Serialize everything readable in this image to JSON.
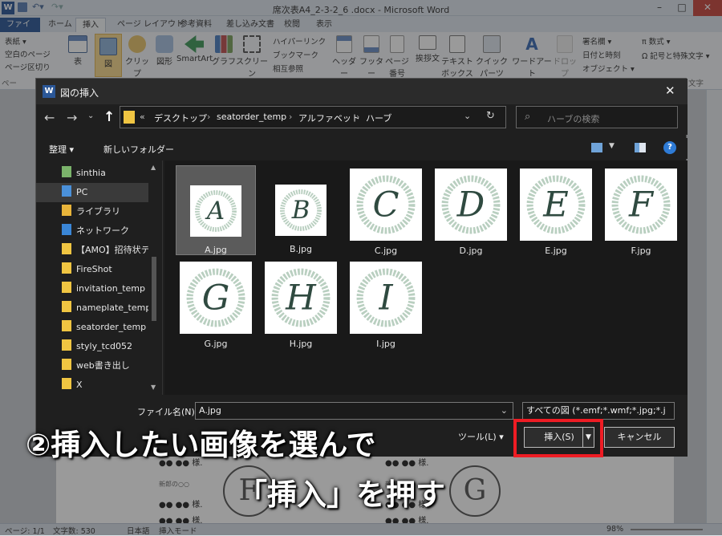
{
  "window": {
    "title": "席次表A4_2-3-2_6 .docx - Microsoft Word"
  },
  "ribbon": {
    "tabs": [
      "ファイル",
      "ホーム",
      "挿入",
      "ページ レイアウト",
      "参考資料",
      "差し込み文書",
      "校閲",
      "表示"
    ],
    "active_tab": "挿入",
    "page_group": [
      "表紙 ▾",
      "空白のページ",
      "ページ区切り"
    ],
    "group_page_label": "ペー",
    "table_label": "表",
    "image_label": "図",
    "clipart_label": "クリップ\nアート",
    "shapes_label": "図形",
    "smartart_label": "SmartArt",
    "chart_label": "グラフ",
    "screenshot_label": "スクリーン\nショット",
    "links": [
      "ハイパーリンク",
      "ブックマーク",
      "相互参照"
    ],
    "header_label": "ヘッダー",
    "footer_label": "フッター",
    "pagenum_label": "ページ\n番号",
    "textbox_label": "テキスト\nボックス",
    "greeting_label": "挨拶文",
    "quickparts_label": "クイック パーツ",
    "wordart_label": "ワードアート",
    "dropcap_label": "ドロップ\nキャップ",
    "right_group": [
      "署名欄 ▾",
      "日付と時刻",
      "オブジェクト ▾"
    ],
    "symbols": [
      "π 数式 ▾",
      "Ω 記号と特殊文字 ▾"
    ],
    "moji_label": "文字"
  },
  "document": {
    "rows": [
      {
        "name": "●● ●●",
        "honor": "様"
      },
      {
        "name": "●● ●●",
        "honor": "様"
      },
      {
        "name": "●● ●●",
        "honor": "様"
      }
    ],
    "caption": "新郎の○○",
    "circle_left": "F",
    "circle_right": "G"
  },
  "statusbar": {
    "page": "ページ: 1/1",
    "words": "文字数: 530",
    "lang": "日本語",
    "mode": "挿入モード",
    "zoom": "98%"
  },
  "dialog": {
    "title": "図の挿入",
    "breadcrumb": [
      "«",
      "デスクトップ",
      "seatorder_temp",
      "アルファベット",
      "ハーブ"
    ],
    "search_placeholder": "ハーブの検索",
    "organize_label": "整理 ▾",
    "new_folder_label": "新しいフォルダー",
    "sidebar": [
      {
        "label": "sinthia",
        "icon": "user-icon"
      },
      {
        "label": "PC",
        "icon": "pc-icon",
        "selected": true
      },
      {
        "label": "ライブラリ",
        "icon": "library-icon"
      },
      {
        "label": "ネットワーク",
        "icon": "network-icon"
      },
      {
        "label": "【AMO】招待状テ",
        "icon": "folder-icon"
      },
      {
        "label": "FireShot",
        "icon": "folder-icon"
      },
      {
        "label": "invitation_temp",
        "icon": "folder-icon"
      },
      {
        "label": "nameplate_temp",
        "icon": "folder-icon"
      },
      {
        "label": "seatorder_temp",
        "icon": "folder-icon"
      },
      {
        "label": "styly_tcd052",
        "icon": "folder-icon"
      },
      {
        "label": "web書き出し",
        "icon": "folder-icon"
      },
      {
        "label": "X",
        "icon": "folder-icon"
      }
    ],
    "files": [
      {
        "name": "A.jpg",
        "letter": "A",
        "selected": true
      },
      {
        "name": "B.jpg",
        "letter": "B"
      },
      {
        "name": "C.jpg",
        "letter": "C"
      },
      {
        "name": "D.jpg",
        "letter": "D"
      },
      {
        "name": "E.jpg",
        "letter": "E"
      },
      {
        "name": "F.jpg",
        "letter": "F"
      },
      {
        "name": "G.jpg",
        "letter": "G"
      },
      {
        "name": "H.jpg",
        "letter": "H"
      },
      {
        "name": "I.jpg",
        "letter": "I"
      }
    ],
    "filename_label": "ファイル名(N):",
    "filename_value": "A.jpg",
    "filetype_value": "すべての図 (*.emf;*.wmf;*.jpg;*.j",
    "tools_label": "ツール(L) ▾",
    "insert_label": "挿入(S)",
    "cancel_label": "キャンセル"
  },
  "annotation": {
    "line1": "②挿入したい画像を選んで",
    "line2": "「挿入」を押す",
    "color": "#ee1c24"
  }
}
